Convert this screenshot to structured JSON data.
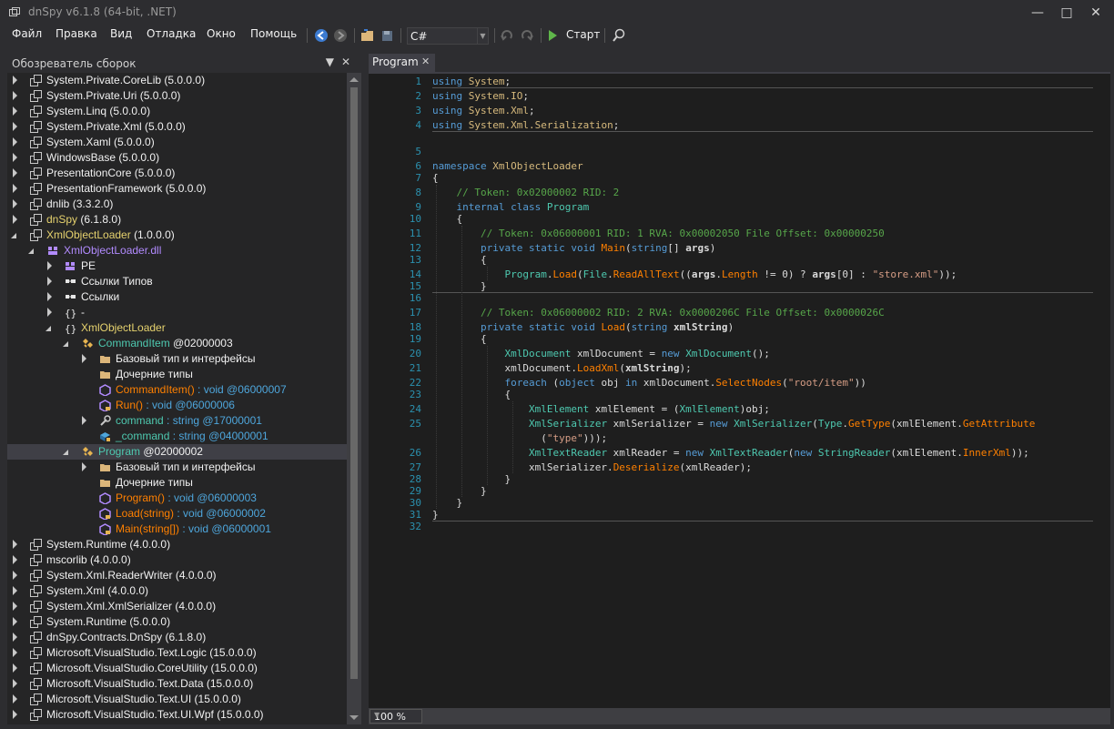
{
  "window": {
    "title": "dnSpy v6.1.8 (64-bit, .NET)"
  },
  "menu": [
    "Файл",
    "Правка",
    "Вид",
    "Отладка",
    "Окно",
    "Помощь"
  ],
  "toolbar": {
    "language": "C#",
    "start_label": "Старт"
  },
  "explorer": {
    "title": "Обозреватель сборок",
    "rows": [
      {
        "label": "System.Private.CoreLib",
        "ver": "(5.0.0.0)"
      },
      {
        "label": "System.Private.Uri",
        "ver": "(5.0.0.0)"
      },
      {
        "label": "System.Linq",
        "ver": "(5.0.0.0)"
      },
      {
        "label": "System.Private.Xml",
        "ver": "(5.0.0.0)"
      },
      {
        "label": "System.Xaml",
        "ver": "(5.0.0.0)"
      },
      {
        "label": "WindowsBase",
        "ver": "(5.0.0.0)"
      },
      {
        "label": "PresentationCore",
        "ver": "(5.0.0.0)"
      },
      {
        "label": "PresentationFramework",
        "ver": "(5.0.0.0)"
      },
      {
        "label": "dnlib",
        "ver": "(3.3.2.0)"
      },
      {
        "label": "dnSpy",
        "ver": "(6.1.8.0)"
      },
      {
        "label": "XmlObjectLoader",
        "ver": "(1.0.0.0)"
      },
      {
        "label": "XmlObjectLoader.dll",
        "ver": ""
      },
      {
        "label": "PE",
        "ver": ""
      },
      {
        "label": "Ссылки Типов",
        "ver": ""
      },
      {
        "label": "Ссылки",
        "ver": ""
      },
      {
        "label": "-",
        "ver": ""
      },
      {
        "label": "XmlObjectLoader",
        "ver": ""
      },
      {
        "label": "CommandItem",
        "ver": "@02000003"
      },
      {
        "label": "Базовый тип и интерфейсы",
        "ver": ""
      },
      {
        "label": "Дочерние типы",
        "ver": ""
      },
      {
        "label": "CommandItem()",
        "ver": ": void @06000007"
      },
      {
        "label": "Run()",
        "ver": ": void @06000006"
      },
      {
        "label": "command",
        "ver": ": string @17000001"
      },
      {
        "label": "_command",
        "ver": ": string @04000001"
      },
      {
        "label": "Program",
        "ver": "@02000002"
      },
      {
        "label": "Базовый тип и интерфейсы",
        "ver": ""
      },
      {
        "label": "Дочерние типы",
        "ver": ""
      },
      {
        "label": "Program()",
        "ver": ": void @06000003"
      },
      {
        "label": "Load(string)",
        "ver": ": void @06000002"
      },
      {
        "label": "Main(string[])",
        "ver": ": void @06000001"
      },
      {
        "label": "System.Runtime",
        "ver": "(4.0.0.0)"
      },
      {
        "label": "mscorlib",
        "ver": "(4.0.0.0)"
      },
      {
        "label": "System.Xml.ReaderWriter",
        "ver": "(4.0.0.0)"
      },
      {
        "label": "System.Xml",
        "ver": "(4.0.0.0)"
      },
      {
        "label": "System.Xml.XmlSerializer",
        "ver": "(4.0.0.0)"
      },
      {
        "label": "System.Runtime",
        "ver": "(5.0.0.0)"
      },
      {
        "label": "dnSpy.Contracts.DnSpy",
        "ver": "(6.1.8.0)"
      },
      {
        "label": "Microsoft.VisualStudio.Text.Logic",
        "ver": "(15.0.0.0)"
      },
      {
        "label": "Microsoft.VisualStudio.CoreUtility",
        "ver": "(15.0.0.0)"
      },
      {
        "label": "Microsoft.VisualStudio.Text.Data",
        "ver": "(15.0.0.0)"
      },
      {
        "label": "Microsoft.VisualStudio.Text.UI",
        "ver": "(15.0.0.0)"
      },
      {
        "label": "Microsoft.VisualStudio.Text.UI.Wpf",
        "ver": "(15.0.0.0)"
      }
    ]
  },
  "tab": {
    "label": "Program"
  },
  "editor": {
    "zoom": "100 %",
    "line_numbers": [
      "1",
      "2",
      "3",
      "4",
      "5",
      "6",
      "7",
      "8",
      "9",
      "10",
      "11",
      "12",
      "13",
      "14",
      "15",
      "16",
      "17",
      "18",
      "19",
      "20",
      "21",
      "22",
      "23",
      "24",
      "25",
      "",
      "26",
      "27",
      "28",
      "29",
      "30",
      "31",
      "32"
    ],
    "lines": [
      [
        [
          "kw",
          "using"
        ],
        [
          "df",
          " "
        ],
        [
          "ns",
          "System"
        ],
        [
          "df",
          ";"
        ]
      ],
      [
        [
          "kw",
          "using"
        ],
        [
          "df",
          " "
        ],
        [
          "ns",
          "System.IO"
        ],
        [
          "df",
          ";"
        ]
      ],
      [
        [
          "kw",
          "using"
        ],
        [
          "df",
          " "
        ],
        [
          "ns",
          "System.Xml"
        ],
        [
          "df",
          ";"
        ]
      ],
      [
        [
          "kw",
          "using"
        ],
        [
          "df",
          " "
        ],
        [
          "ns",
          "System.Xml.Serialization"
        ],
        [
          "df",
          ";"
        ]
      ],
      [],
      [
        [
          "kw",
          "namespace"
        ],
        [
          "df",
          " "
        ],
        [
          "ns",
          "XmlObjectLoader"
        ]
      ],
      [
        [
          "df",
          "{"
        ]
      ],
      [
        [
          "df",
          "    "
        ],
        [
          "cm",
          "// Token: 0x02000002 RID: 2"
        ]
      ],
      [
        [
          "df",
          "    "
        ],
        [
          "kw",
          "internal class"
        ],
        [
          "df",
          " "
        ],
        [
          "ty",
          "Program"
        ]
      ],
      [
        [
          "df",
          "    {"
        ]
      ],
      [
        [
          "df",
          "        "
        ],
        [
          "cm",
          "// Token: 0x06000001 RID: 1 RVA: 0x00002050 File Offset: 0x00000250"
        ]
      ],
      [
        [
          "df",
          "        "
        ],
        [
          "kw",
          "private static void"
        ],
        [
          "df",
          " "
        ],
        [
          "mt",
          "Main"
        ],
        [
          "df",
          "("
        ],
        [
          "kw",
          "string"
        ],
        [
          "df",
          "[] "
        ],
        [
          "pa",
          "args"
        ],
        [
          "df",
          ")"
        ]
      ],
      [
        [
          "df",
          "        {"
        ]
      ],
      [
        [
          "df",
          "            "
        ],
        [
          "ty",
          "Program"
        ],
        [
          "df",
          "."
        ],
        [
          "mt",
          "Load"
        ],
        [
          "df",
          "("
        ],
        [
          "ty",
          "File"
        ],
        [
          "df",
          "."
        ],
        [
          "mt",
          "ReadAllText"
        ],
        [
          "df",
          "(("
        ],
        [
          "pa",
          "args"
        ],
        [
          "df",
          "."
        ],
        [
          "mt",
          "Length"
        ],
        [
          "df",
          " != 0) ? "
        ],
        [
          "pa",
          "args"
        ],
        [
          "df",
          "[0] : "
        ],
        [
          "st",
          "\"store.xml\""
        ],
        [
          "df",
          "));"
        ]
      ],
      [
        [
          "df",
          "        }"
        ]
      ],
      [],
      [
        [
          "df",
          "        "
        ],
        [
          "cm",
          "// Token: 0x06000002 RID: 2 RVA: 0x0000206C File Offset: 0x0000026C"
        ]
      ],
      [
        [
          "df",
          "        "
        ],
        [
          "kw",
          "private static void"
        ],
        [
          "df",
          " "
        ],
        [
          "mt",
          "Load"
        ],
        [
          "df",
          "("
        ],
        [
          "kw",
          "string"
        ],
        [
          "df",
          " "
        ],
        [
          "pa",
          "xmlString"
        ],
        [
          "df",
          ")"
        ]
      ],
      [
        [
          "df",
          "        {"
        ]
      ],
      [
        [
          "df",
          "            "
        ],
        [
          "ty",
          "XmlDocument"
        ],
        [
          "df",
          " xmlDocument = "
        ],
        [
          "kw",
          "new"
        ],
        [
          "df",
          " "
        ],
        [
          "ty",
          "XmlDocument"
        ],
        [
          "df",
          "();"
        ]
      ],
      [
        [
          "df",
          "            xmlDocument."
        ],
        [
          "mt",
          "LoadXml"
        ],
        [
          "df",
          "("
        ],
        [
          "pa",
          "xmlString"
        ],
        [
          "df",
          ");"
        ]
      ],
      [
        [
          "df",
          "            "
        ],
        [
          "kw",
          "foreach"
        ],
        [
          "df",
          " ("
        ],
        [
          "kw",
          "object"
        ],
        [
          "df",
          " obj "
        ],
        [
          "kw",
          "in"
        ],
        [
          "df",
          " xmlDocument."
        ],
        [
          "mt",
          "SelectNodes"
        ],
        [
          "df",
          "("
        ],
        [
          "st",
          "\"root/item\""
        ],
        [
          "df",
          "))"
        ]
      ],
      [
        [
          "df",
          "            {"
        ]
      ],
      [
        [
          "df",
          "                "
        ],
        [
          "ty",
          "XmlElement"
        ],
        [
          "df",
          " xmlElement = ("
        ],
        [
          "ty",
          "XmlElement"
        ],
        [
          "df",
          ")obj;"
        ]
      ],
      [
        [
          "df",
          "                "
        ],
        [
          "ty",
          "XmlSerializer"
        ],
        [
          "df",
          " xmlSerializer = "
        ],
        [
          "kw",
          "new"
        ],
        [
          "df",
          " "
        ],
        [
          "ty",
          "XmlSerializer"
        ],
        [
          "df",
          "("
        ],
        [
          "ty",
          "Type"
        ],
        [
          "df",
          "."
        ],
        [
          "mt",
          "GetType"
        ],
        [
          "df",
          "(xmlElement."
        ],
        [
          "mt",
          "GetAttribute"
        ]
      ],
      [
        [
          "df",
          "                  ("
        ],
        [
          "st",
          "\"type\""
        ],
        [
          "df",
          ")));"
        ]
      ],
      [
        [
          "df",
          "                "
        ],
        [
          "ty",
          "XmlTextReader"
        ],
        [
          "df",
          " xmlReader = "
        ],
        [
          "kw",
          "new"
        ],
        [
          "df",
          " "
        ],
        [
          "ty",
          "XmlTextReader"
        ],
        [
          "df",
          "("
        ],
        [
          "kw",
          "new"
        ],
        [
          "df",
          " "
        ],
        [
          "ty",
          "StringReader"
        ],
        [
          "df",
          "(xmlElement."
        ],
        [
          "mt",
          "InnerXml"
        ],
        [
          "df",
          "));"
        ]
      ],
      [
        [
          "df",
          "                xmlSerializer."
        ],
        [
          "mt",
          "Deserialize"
        ],
        [
          "df",
          "(xmlReader);"
        ]
      ],
      [
        [
          "df",
          "            }"
        ]
      ],
      [
        [
          "df",
          "        }"
        ]
      ],
      [
        [
          "df",
          "    }"
        ]
      ],
      [
        [
          "df",
          "}"
        ]
      ],
      []
    ]
  },
  "colors": {
    "keyword": "#569cd6",
    "type": "#4ec9b0",
    "namespace": "#d7ba7d",
    "comment": "#57a64a",
    "string": "#d69d85",
    "method": "#ff8000",
    "line_number": "#2b91af",
    "assembly_yellow": "#e6d26e",
    "tree_type": "#4ec9b0",
    "tree_method": "#ff8000",
    "tree_property": "#4ec9b0",
    "tree_namespace": "#e6d26e",
    "tree_module": "#b28bff"
  }
}
